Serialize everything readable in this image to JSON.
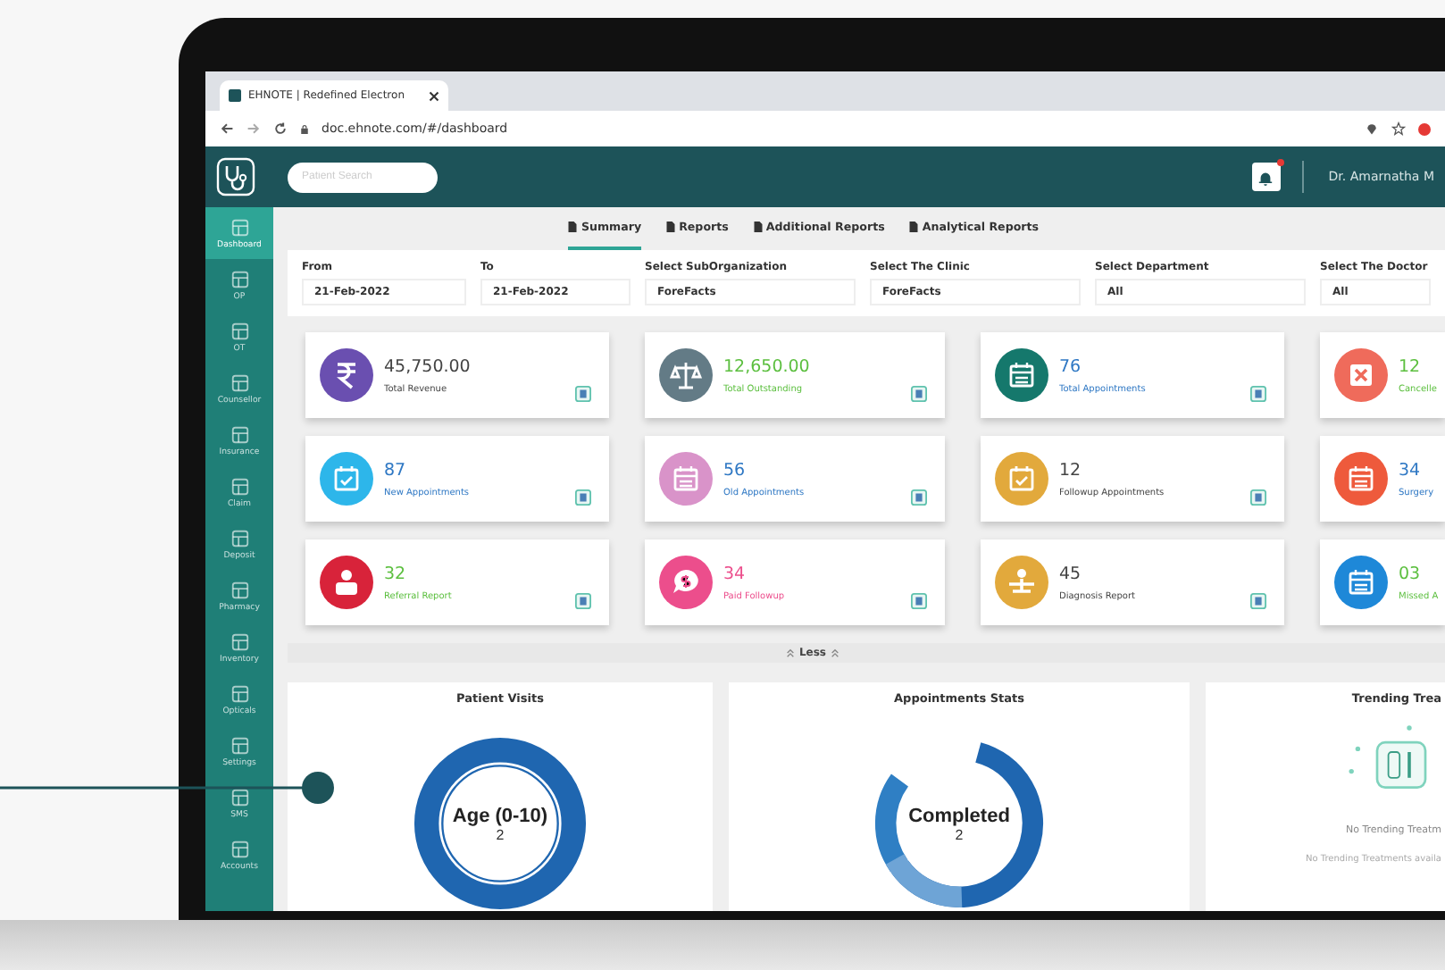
{
  "browser": {
    "tab_title": "EHNOTE | Redefined Electron",
    "url": "doc.ehnote.com/#/dashboard"
  },
  "header": {
    "search": {
      "placeholder": "Patient Search"
    },
    "notification": {
      "unread": true
    },
    "user": "Dr. Amarnatha M"
  },
  "sidebar": {
    "items": [
      {
        "label": "Dashboard",
        "selected": true
      },
      {
        "label": "OP",
        "selected": false
      },
      {
        "label": "OT",
        "selected": false
      },
      {
        "label": "Counsellor",
        "selected": false
      },
      {
        "label": "Insurance",
        "selected": false
      },
      {
        "label": "Claim",
        "selected": false
      },
      {
        "label": "Deposit",
        "selected": false
      },
      {
        "label": "Pharmacy",
        "selected": false
      },
      {
        "label": "Inventory",
        "selected": false
      },
      {
        "label": "Opticals",
        "selected": false
      },
      {
        "label": "Settings",
        "selected": false
      },
      {
        "label": "SMS",
        "selected": false
      },
      {
        "label": "Accounts",
        "selected": false
      }
    ]
  },
  "tabs": [
    {
      "label": "Summary",
      "selected": true
    },
    {
      "label": "Reports",
      "selected": false
    },
    {
      "label": "Additional Reports",
      "selected": false
    },
    {
      "label": "Analytical Reports",
      "selected": false
    }
  ],
  "filters": [
    {
      "label": "From",
      "value": "21-Feb-2022"
    },
    {
      "label": "To",
      "value": "21-Feb-2022"
    },
    {
      "label": "Select SubOrganization",
      "value": "ForeFacts"
    },
    {
      "label": "Select The Clinic",
      "value": "ForeFacts"
    },
    {
      "label": "Select Department",
      "value": "All"
    },
    {
      "label": "Select The Doctor",
      "value": "All"
    }
  ],
  "cards": [
    {
      "kind": "rupee",
      "color": "#6a4fb0",
      "value": {
        "text": "45,750.00",
        "color": "#444444"
      },
      "label": "Total Revenue"
    },
    {
      "kind": "scale",
      "color": "#637b86",
      "value": {
        "text": "12,650.00",
        "color": "#5cbf3f"
      },
      "label": "Total Outstanding"
    },
    {
      "kind": "calendar",
      "color": "#15786c",
      "value": {
        "text": "76",
        "color": "#2f78c4"
      },
      "label": "Total Appointments"
    },
    {
      "kind": "cross",
      "color": "#ef6b5b",
      "value": {
        "text": "12",
        "color": "#5cbf3f"
      },
      "label": "Cancelle"
    },
    {
      "kind": "check",
      "color": "#2db6ea",
      "value": {
        "text": "87",
        "color": "#2f78c4"
      },
      "label": "New Appointments"
    },
    {
      "kind": "calendar",
      "color": "#d993c9",
      "value": {
        "text": "56",
        "color": "#2f78c4"
      },
      "label": "Old Appointments"
    },
    {
      "kind": "check",
      "color": "#e2a93c",
      "value": {
        "text": "12",
        "color": "#444444"
      },
      "label": "Followup Appointments"
    },
    {
      "kind": "calendar",
      "color": "#ee5a3c",
      "value": {
        "text": "34",
        "color": "#2f78c4"
      },
      "label": "Surgery"
    },
    {
      "kind": "person",
      "color": "#d8233a",
      "value": {
        "text": "32",
        "color": "#5cbf3f"
      },
      "label": "Referral Report"
    },
    {
      "kind": "chat",
      "color": "#ec4e8c",
      "value": {
        "text": "34",
        "color": "#ec4e8c"
      },
      "label": "Paid Followup"
    },
    {
      "kind": "desk",
      "color": "#e2a93c",
      "value": {
        "text": "45",
        "color": "#444444"
      },
      "label": "Diagnosis Report"
    },
    {
      "kind": "calendar",
      "color": "#1e88d8",
      "value": {
        "text": "03",
        "color": "#5cbf3f"
      },
      "label": "Missed A"
    }
  ],
  "toggle": {
    "label": "Less"
  },
  "panels": [
    {
      "kind": "donut",
      "title": "Patient Visits",
      "center": "Age (0-10)",
      "count": "2"
    },
    {
      "kind": "segments",
      "title": "Appointments Stats",
      "center": "Completed",
      "count": "2"
    },
    {
      "kind": "empty",
      "title": "Trending Trea",
      "message": "No Trending Treatm",
      "detail": "No Trending Treatments availa"
    }
  ]
}
